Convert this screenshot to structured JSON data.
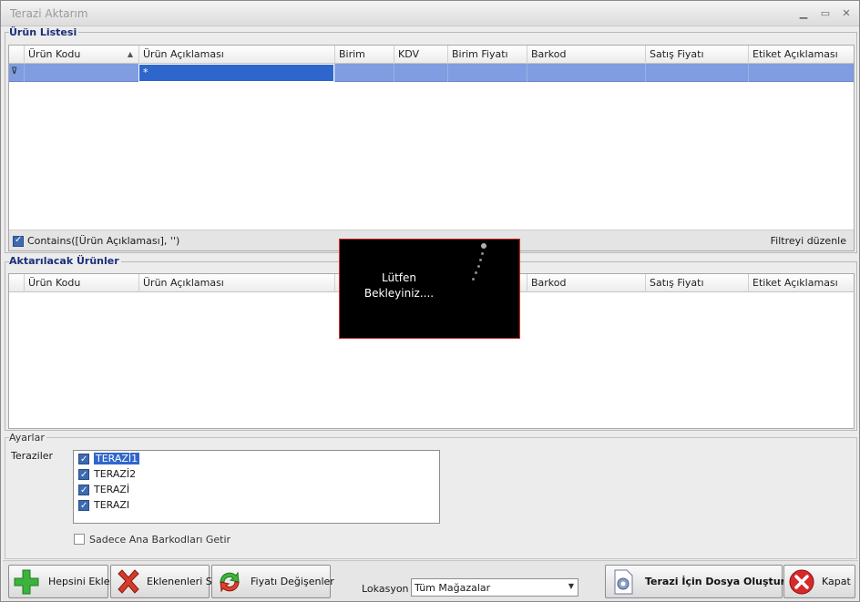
{
  "window": {
    "title": "Terazi Aktarım",
    "minimize_icon": "minimize-icon",
    "maximize_icon": "maximize-icon",
    "close_icon": "close-icon"
  },
  "urun_listesi": {
    "group_title": "Ürün Listesi",
    "columns": [
      "Ürün Kodu",
      "Ürün Açıklaması",
      "Birim",
      "KDV",
      "Birim Fiyatı",
      "Barkod",
      "Satış Fiyatı",
      "Etiket Açıklaması"
    ],
    "filter_row_value": "*",
    "filter_text": "Contains([Ürün Açıklaması], '')",
    "filter_edit_link": "Filtreyi düzenle"
  },
  "aktarilacak": {
    "group_title": "Aktarılacak Ürünler",
    "columns": [
      "Ürün Kodu",
      "Ürün Açıklaması",
      "",
      "",
      "",
      "Barkod",
      "Satış Fiyatı",
      "Etiket Açıklaması"
    ]
  },
  "loading": {
    "line1": "Lütfen",
    "line2": "Bekleyiniz...."
  },
  "ayarlar": {
    "group_title": "Ayarlar",
    "teraziler_label": "Teraziler",
    "scales": [
      {
        "label": "TERAZİ1",
        "checked": true,
        "selected": true
      },
      {
        "label": "TERAZİ2",
        "checked": true,
        "selected": false
      },
      {
        "label": "TERAZİ",
        "checked": true,
        "selected": false
      },
      {
        "label": "TERAZI",
        "checked": true,
        "selected": false
      }
    ],
    "sadece_ana_label": "Sadece Ana Barkodları Getir"
  },
  "bottom": {
    "hepsini_ekle": "Hepsini Ekle",
    "eklenenleri_sil": "Eklenenleri Sil",
    "fiyati_degisenler": "Fiyatı Değişenler",
    "lokasyon_label": "Lokasyon",
    "lokasyon_value": "Tüm Mağazalar",
    "dosya_olustur": "Terazi İçin Dosya Oluştur",
    "kapat": "Kapat"
  },
  "colors": {
    "accent": "#2f66cc",
    "filter_row": "#7f9de0",
    "group_title": "#1a2f7a",
    "loading_border": "#d42a2a"
  }
}
